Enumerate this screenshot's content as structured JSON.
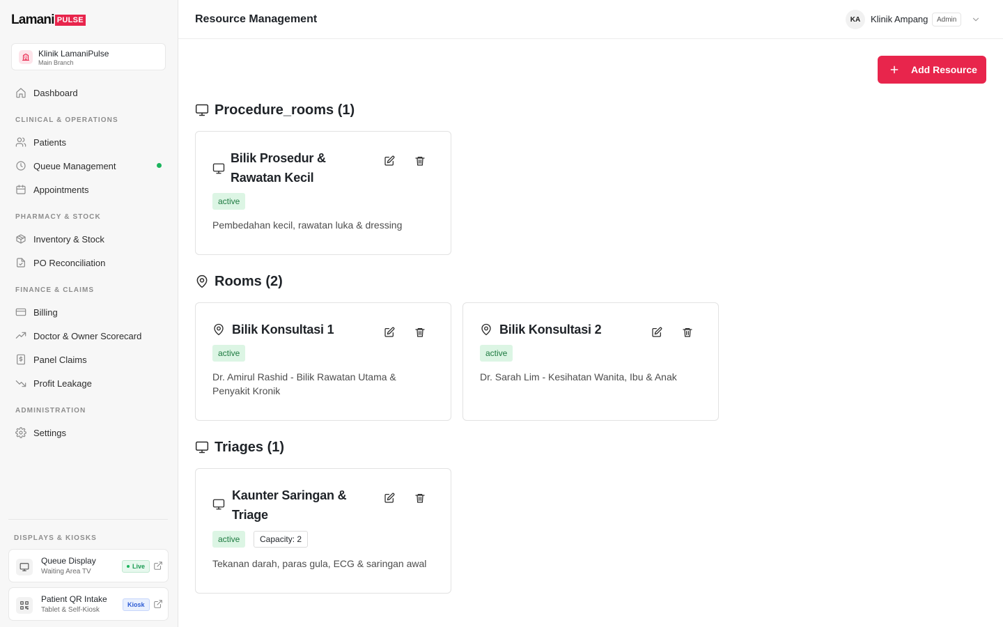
{
  "brand": {
    "word": "Lamani",
    "badge": "PULSE",
    "accent": "#e8254c"
  },
  "clinic": {
    "name": "Klinik LamaniPulse",
    "branch": "Main Branch"
  },
  "nav": {
    "dashboard": "Dashboard",
    "sections": {
      "clinical": "CLINICAL & OPERATIONS",
      "pharmacy": "PHARMACY & STOCK",
      "finance": "FINANCE & CLAIMS",
      "admin": "ADMINISTRATION",
      "displays": "DISPLAYS & KIOSKS"
    },
    "items": {
      "patients": "Patients",
      "queue": "Queue Management",
      "appointments": "Appointments",
      "inventory": "Inventory & Stock",
      "po": "PO Reconciliation",
      "billing": "Billing",
      "scorecard": "Doctor & Owner Scorecard",
      "panel_claims": "Panel Claims",
      "profit_leakage": "Profit Leakage",
      "settings": "Settings"
    }
  },
  "kiosks": [
    {
      "title": "Queue Display",
      "subtitle": "Waiting Area TV",
      "badge": "Live",
      "icon": "monitor-icon"
    },
    {
      "title": "Patient QR Intake",
      "subtitle": "Tablet & Self-Kiosk",
      "badge": "Kiosk",
      "icon": "qr-code-icon"
    }
  ],
  "header": {
    "title": "Resource Management",
    "user": {
      "initials": "KA",
      "name": "Klinik Ampang",
      "role": "Admin"
    }
  },
  "actions": {
    "add_resource": "Add Resource"
  },
  "sections": [
    {
      "heading": "Procedure_rooms (1)",
      "icon": "monitor-icon",
      "cards": [
        {
          "title": "Bilik Prosedur & Rawatan Kecil",
          "status": "active",
          "description": "Pembedahan kecil, rawatan luka & dressing"
        }
      ]
    },
    {
      "heading": "Rooms (2)",
      "icon": "map-pin-icon",
      "cards": [
        {
          "title": "Bilik Konsultasi 1",
          "status": "active",
          "description": "Dr. Amirul Rashid - Bilik Rawatan Utama & Penyakit Kronik"
        },
        {
          "title": "Bilik Konsultasi 2",
          "status": "active",
          "description": "Dr. Sarah Lim - Kesihatan Wanita, Ibu & Anak"
        }
      ]
    },
    {
      "heading": "Triages (1)",
      "icon": "monitor-icon",
      "cards": [
        {
          "title": "Kaunter Saringan & Triage",
          "status": "active",
          "capacity": "Capacity: 2",
          "description": "Tekanan darah, paras gula, ECG & saringan awal"
        }
      ]
    }
  ],
  "colors": {
    "active_bg": "#dcf5e4",
    "active_text": "#1d7a40",
    "live_dot": "#1bb45d"
  }
}
